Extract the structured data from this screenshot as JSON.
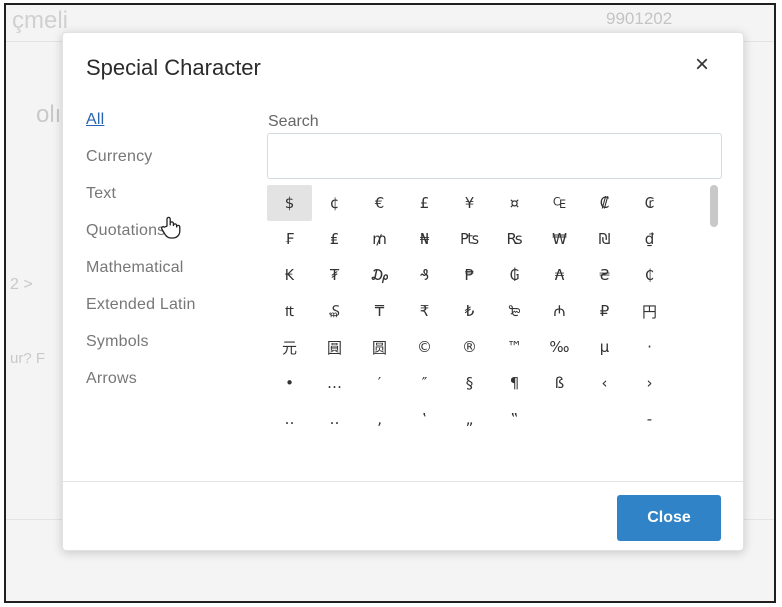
{
  "background": {
    "top_left_text": "çmeli",
    "top_right_value": "9901202",
    "left_mid_text": "olı",
    "left_number": "2 >",
    "left_link": "ur? F"
  },
  "modal": {
    "title": "Special Character",
    "close_glyph": "×",
    "categories": [
      {
        "label": "All",
        "active": true
      },
      {
        "label": "Currency",
        "active": false
      },
      {
        "label": "Text",
        "active": false
      },
      {
        "label": "Quotations",
        "active": false
      },
      {
        "label": "Mathematical",
        "active": false
      },
      {
        "label": "Extended Latin",
        "active": false
      },
      {
        "label": "Symbols",
        "active": false
      },
      {
        "label": "Arrows",
        "active": false
      }
    ],
    "search": {
      "label": "Search",
      "value": "",
      "placeholder": ""
    },
    "characters": [
      "$",
      "¢",
      "€",
      "£",
      "¥",
      "¤",
      "₠",
      "₡",
      "₢",
      "₣",
      "₤",
      "₥",
      "₦",
      "₧",
      "₨",
      "₩",
      "₪",
      "₫",
      "₭",
      "₮",
      "₯",
      "₰",
      "₱",
      "₲",
      "₳",
      "₴",
      "₵",
      "₶",
      "₷",
      "₸",
      "₹",
      "₺",
      "₻",
      "₼",
      "₽",
      "円",
      "元",
      "圓",
      "圆",
      "©",
      "®",
      "™",
      "‰",
      "µ",
      "·",
      "•",
      "…",
      "′",
      "″",
      "§",
      "¶",
      "ß",
      "‹",
      "›",
      "‥",
      "‥",
      "‚",
      "‛",
      "„",
      "‟",
      "",
      "",
      "‐"
    ],
    "selected_index": 0,
    "close_button_label": "Close"
  },
  "colors": {
    "accent": "#2f83c6",
    "active_link": "#2563b0"
  },
  "icons": {
    "close": "close-icon",
    "cursor": "hand-cursor-icon"
  }
}
